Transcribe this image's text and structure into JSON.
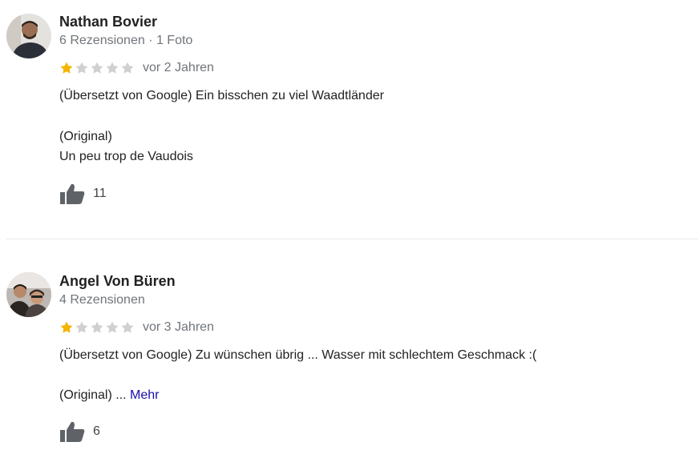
{
  "colors": {
    "star_filled": "#f4b400",
    "star_empty": "#d0d0d0",
    "link": "#1a0dab",
    "muted": "#70757a"
  },
  "reviews": [
    {
      "author": "Nathan Bovier",
      "meta": "6 Rezensionen · 1 Foto",
      "rating": 1,
      "max_rating": 5,
      "time": "vor 2 Jahren",
      "translated": "(Übersetzt von Google) Ein bisschen zu viel Waadtländer",
      "original_label": "(Original)",
      "original_text": "Un peu trop de Vaudois",
      "likes": "11",
      "like_icon": "thumbs-up-icon"
    },
    {
      "author": "Angel Von Büren",
      "meta": "4 Rezensionen",
      "rating": 1,
      "max_rating": 5,
      "time": "vor 3 Jahren",
      "translated": "(Übersetzt von Google) Zu wünschen übrig ... Wasser mit schlechtem Geschmack :(",
      "original_label": "(Original) ...",
      "more": "Mehr",
      "likes": "6",
      "like_icon": "thumbs-up-icon"
    }
  ]
}
